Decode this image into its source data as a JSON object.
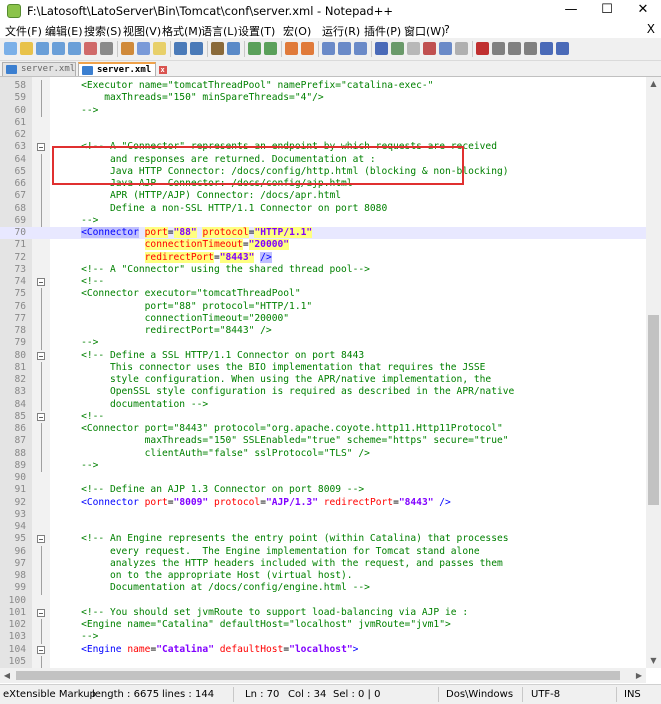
{
  "window": {
    "title": "F:\\Latosoft\\LatoServer\\Bin\\Tomcat\\conf\\server.xml - Notepad++",
    "minimize": "—",
    "maximize": "☐",
    "close": "✕"
  },
  "menu": [
    "文件(F)",
    "编辑(E)",
    "搜索(S)",
    "视图(V)",
    "格式(M)",
    "语言(L)",
    "设置(T)",
    "宏(O)",
    "运行(R)",
    "插件(P)",
    "窗口(W)",
    "?"
  ],
  "menu_close": "X",
  "tabs": [
    {
      "label": "server.xml",
      "active": false
    },
    {
      "label": "server.xml",
      "active": true
    }
  ],
  "lines": [
    {
      "n": "58",
      "fold": "line",
      "parts": [
        [
          "com",
          "    <Executor name=\"tomcatThreadPool\" namePrefix=\"catalina-exec-\""
        ]
      ]
    },
    {
      "n": "59",
      "fold": "line",
      "parts": [
        [
          "com",
          "        maxThreads=\"150\" minSpareThreads=\"4\"/>"
        ]
      ]
    },
    {
      "n": "60",
      "fold": "line",
      "parts": [
        [
          "com",
          "    -->"
        ]
      ]
    },
    {
      "n": "61",
      "fold": "",
      "parts": [
        [
          "txt",
          ""
        ]
      ]
    },
    {
      "n": "62",
      "fold": "",
      "parts": [
        [
          "txt",
          ""
        ]
      ]
    },
    {
      "n": "63",
      "fold": "box",
      "parts": [
        [
          "com",
          "    <!-- A \"Connector\" represents an endpoint by which requests are received"
        ]
      ]
    },
    {
      "n": "64",
      "fold": "line",
      "parts": [
        [
          "com",
          "         and responses are returned. Documentation at :"
        ]
      ]
    },
    {
      "n": "65",
      "fold": "line",
      "parts": [
        [
          "com",
          "         Java HTTP Connector: /docs/config/http.html (blocking & non-blocking)"
        ]
      ]
    },
    {
      "n": "66",
      "fold": "line",
      "parts": [
        [
          "com",
          "         Java AJP  Connector: /docs/config/ajp.html"
        ]
      ]
    },
    {
      "n": "67",
      "fold": "line",
      "parts": [
        [
          "com",
          "         APR (HTTP/AJP) Connector: /docs/apr.html"
        ]
      ]
    },
    {
      "n": "68",
      "fold": "line",
      "parts": [
        [
          "com",
          "         Define a non-SSL HTTP/1.1 Connector on port 8080"
        ]
      ]
    },
    {
      "n": "69",
      "fold": "line",
      "parts": [
        [
          "com",
          "    -->"
        ]
      ]
    },
    {
      "n": "70",
      "fold": "",
      "cur": true,
      "parts": [
        [
          "txt",
          "    "
        ],
        [
          "tag2",
          "<Connector"
        ],
        [
          "txt",
          " "
        ],
        [
          "attrhl",
          "port"
        ],
        [
          "txt",
          "="
        ],
        [
          "valhl",
          "\"88\""
        ],
        [
          "txt",
          " "
        ],
        [
          "attrhl",
          "protocol"
        ],
        [
          "txt",
          "="
        ],
        [
          "valhl",
          "\"HTTP/1.1\""
        ]
      ]
    },
    {
      "n": "71",
      "fold": "",
      "parts": [
        [
          "txt",
          "               "
        ],
        [
          "attrhl",
          "connectionTimeout"
        ],
        [
          "txt",
          "="
        ],
        [
          "valhl",
          "\"20000\""
        ]
      ]
    },
    {
      "n": "72",
      "fold": "",
      "parts": [
        [
          "txt",
          "               "
        ],
        [
          "attrhl",
          "redirectPort"
        ],
        [
          "txt",
          "="
        ],
        [
          "valhl",
          "\"8443\""
        ],
        [
          "txt",
          " "
        ],
        [
          "tag2",
          "/>"
        ]
      ]
    },
    {
      "n": "73",
      "fold": "",
      "parts": [
        [
          "com",
          "    <!-- A \"Connector\" using the shared thread pool-->"
        ]
      ]
    },
    {
      "n": "74",
      "fold": "box",
      "parts": [
        [
          "com",
          "    <!--"
        ]
      ]
    },
    {
      "n": "75",
      "fold": "line",
      "parts": [
        [
          "com",
          "    <Connector executor=\"tomcatThreadPool\""
        ]
      ]
    },
    {
      "n": "76",
      "fold": "line",
      "parts": [
        [
          "com",
          "               port=\"88\" protocol=\"HTTP/1.1\""
        ]
      ]
    },
    {
      "n": "77",
      "fold": "line",
      "parts": [
        [
          "com",
          "               connectionTimeout=\"20000\""
        ]
      ]
    },
    {
      "n": "78",
      "fold": "line",
      "parts": [
        [
          "com",
          "               redirectPort=\"8443\" />"
        ]
      ]
    },
    {
      "n": "79",
      "fold": "line",
      "parts": [
        [
          "com",
          "    -->"
        ]
      ]
    },
    {
      "n": "80",
      "fold": "box",
      "parts": [
        [
          "com",
          "    <!-- Define a SSL HTTP/1.1 Connector on port 8443"
        ]
      ]
    },
    {
      "n": "81",
      "fold": "line",
      "parts": [
        [
          "com",
          "         This connector uses the BIO implementation that requires the JSSE"
        ]
      ]
    },
    {
      "n": "82",
      "fold": "line",
      "parts": [
        [
          "com",
          "         style configuration. When using the APR/native implementation, the"
        ]
      ]
    },
    {
      "n": "83",
      "fold": "line",
      "parts": [
        [
          "com",
          "         OpenSSL style configuration is required as described in the APR/native"
        ]
      ]
    },
    {
      "n": "84",
      "fold": "line",
      "parts": [
        [
          "com",
          "         documentation -->"
        ]
      ]
    },
    {
      "n": "85",
      "fold": "box",
      "parts": [
        [
          "com",
          "    <!--"
        ]
      ]
    },
    {
      "n": "86",
      "fold": "line",
      "parts": [
        [
          "com",
          "    <Connector port=\"8443\" protocol=\"org.apache.coyote.http11.Http11Protocol\""
        ]
      ]
    },
    {
      "n": "87",
      "fold": "line",
      "parts": [
        [
          "com",
          "               maxThreads=\"150\" SSLEnabled=\"true\" scheme=\"https\" secure=\"true\""
        ]
      ]
    },
    {
      "n": "88",
      "fold": "line",
      "parts": [
        [
          "com",
          "               clientAuth=\"false\" sslProtocol=\"TLS\" />"
        ]
      ]
    },
    {
      "n": "89",
      "fold": "line",
      "parts": [
        [
          "com",
          "    -->"
        ]
      ]
    },
    {
      "n": "90",
      "fold": "",
      "parts": [
        [
          "txt",
          ""
        ]
      ]
    },
    {
      "n": "91",
      "fold": "",
      "parts": [
        [
          "com",
          "    <!-- Define an AJP 1.3 Connector on port 8009 -->"
        ]
      ]
    },
    {
      "n": "92",
      "fold": "",
      "parts": [
        [
          "txt",
          "    "
        ],
        [
          "tag",
          "<Connector"
        ],
        [
          "txt",
          " "
        ],
        [
          "attr",
          "port"
        ],
        [
          "txt",
          "="
        ],
        [
          "val",
          "\"8009\""
        ],
        [
          "txt",
          " "
        ],
        [
          "attr",
          "protocol"
        ],
        [
          "txt",
          "="
        ],
        [
          "val",
          "\"AJP/1.3\""
        ],
        [
          "txt",
          " "
        ],
        [
          "attr",
          "redirectPort"
        ],
        [
          "txt",
          "="
        ],
        [
          "val",
          "\"8443\""
        ],
        [
          "txt",
          " "
        ],
        [
          "tag",
          "/>"
        ]
      ]
    },
    {
      "n": "93",
      "fold": "",
      "parts": [
        [
          "txt",
          ""
        ]
      ]
    },
    {
      "n": "94",
      "fold": "",
      "parts": [
        [
          "txt",
          ""
        ]
      ]
    },
    {
      "n": "95",
      "fold": "box",
      "parts": [
        [
          "com",
          "    <!-- An Engine represents the entry point (within Catalina) that processes"
        ]
      ]
    },
    {
      "n": "96",
      "fold": "line",
      "parts": [
        [
          "com",
          "         every request.  The Engine implementation for Tomcat stand alone"
        ]
      ]
    },
    {
      "n": "97",
      "fold": "line",
      "parts": [
        [
          "com",
          "         analyzes the HTTP headers included with the request, and passes them"
        ]
      ]
    },
    {
      "n": "98",
      "fold": "line",
      "parts": [
        [
          "com",
          "         on to the appropriate Host (virtual host)."
        ]
      ]
    },
    {
      "n": "99",
      "fold": "line",
      "parts": [
        [
          "com",
          "         Documentation at /docs/config/engine.html -->"
        ]
      ]
    },
    {
      "n": "100",
      "fold": "",
      "parts": [
        [
          "txt",
          ""
        ]
      ]
    },
    {
      "n": "101",
      "fold": "box",
      "parts": [
        [
          "com",
          "    <!-- You should set jvmRoute to support load-balancing via AJP ie :"
        ]
      ]
    },
    {
      "n": "102",
      "fold": "line",
      "parts": [
        [
          "com",
          "    <Engine name=\"Catalina\" defaultHost=\"localhost\" jvmRoute=\"jvm1\">"
        ]
      ]
    },
    {
      "n": "103",
      "fold": "line",
      "parts": [
        [
          "com",
          "    -->"
        ]
      ]
    },
    {
      "n": "104",
      "fold": "box",
      "parts": [
        [
          "txt",
          "    "
        ],
        [
          "tag",
          "<Engine"
        ],
        [
          "txt",
          " "
        ],
        [
          "attr",
          "name"
        ],
        [
          "txt",
          "="
        ],
        [
          "val",
          "\"Catalina\""
        ],
        [
          "txt",
          " "
        ],
        [
          "attr",
          "defaultHost"
        ],
        [
          "txt",
          "="
        ],
        [
          "val",
          "\"localhost\""
        ],
        [
          "tag",
          ">"
        ]
      ]
    },
    {
      "n": "105",
      "fold": "line",
      "parts": [
        [
          "txt",
          ""
        ]
      ]
    }
  ],
  "status": {
    "lang": "eXtensible Markup",
    "length": "length : 6675",
    "lines": "lines : 144",
    "ln": "Ln : 70",
    "col": "Col : 34",
    "sel": "Sel : 0 | 0",
    "eol": "Dos\\Windows",
    "enc": "UTF-8",
    "ins": "INS"
  }
}
